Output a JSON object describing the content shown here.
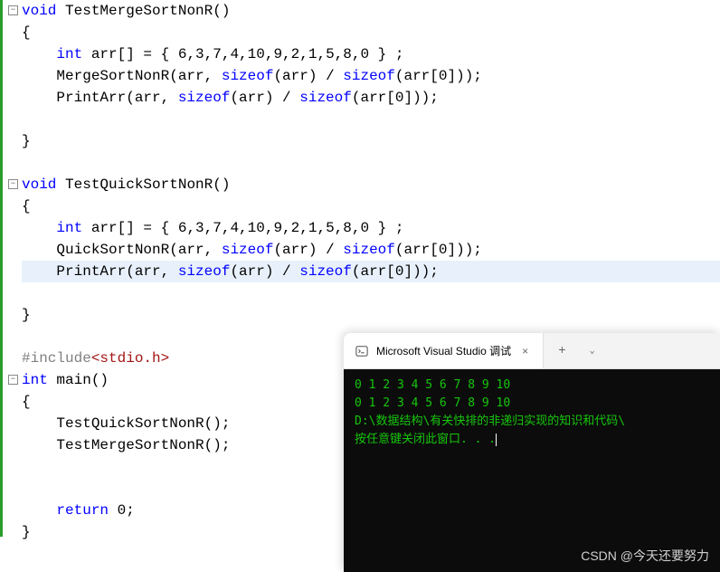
{
  "code": {
    "lines": [
      {
        "collapse": true,
        "segments": [
          {
            "cls": "kw",
            "t": "void"
          },
          {
            "cls": "",
            "t": " "
          },
          {
            "cls": "fn",
            "t": "TestMergeSortNonR"
          },
          {
            "cls": "",
            "t": "()"
          }
        ]
      },
      {
        "segments": [
          {
            "cls": "",
            "t": "{"
          }
        ]
      },
      {
        "segments": [
          {
            "cls": "",
            "t": "    "
          },
          {
            "cls": "kw",
            "t": "int"
          },
          {
            "cls": "",
            "t": " arr[] = { 6,3,7,4,10,9,2,1,5,8,0 } ;"
          }
        ]
      },
      {
        "segments": [
          {
            "cls": "",
            "t": "    MergeSortNonR(arr, "
          },
          {
            "cls": "kw",
            "t": "sizeof"
          },
          {
            "cls": "",
            "t": "(arr) / "
          },
          {
            "cls": "kw",
            "t": "sizeof"
          },
          {
            "cls": "",
            "t": "(arr[0]));"
          }
        ]
      },
      {
        "segments": [
          {
            "cls": "",
            "t": "    PrintArr(arr, "
          },
          {
            "cls": "kw",
            "t": "sizeof"
          },
          {
            "cls": "",
            "t": "(arr) / "
          },
          {
            "cls": "kw",
            "t": "sizeof"
          },
          {
            "cls": "",
            "t": "(arr[0]));"
          }
        ]
      },
      {
        "segments": [
          {
            "cls": "",
            "t": ""
          }
        ]
      },
      {
        "segments": [
          {
            "cls": "",
            "t": "}"
          }
        ]
      },
      {
        "segments": [
          {
            "cls": "",
            "t": ""
          }
        ]
      },
      {
        "collapse": true,
        "segments": [
          {
            "cls": "kw",
            "t": "void"
          },
          {
            "cls": "",
            "t": " "
          },
          {
            "cls": "fn",
            "t": "TestQuickSortNonR"
          },
          {
            "cls": "",
            "t": "()"
          }
        ]
      },
      {
        "segments": [
          {
            "cls": "",
            "t": "{"
          }
        ]
      },
      {
        "segments": [
          {
            "cls": "",
            "t": "    "
          },
          {
            "cls": "kw",
            "t": "int"
          },
          {
            "cls": "",
            "t": " arr[] = { 6,3,7,4,10,9,2,1,5,8,0 } ;"
          }
        ]
      },
      {
        "segments": [
          {
            "cls": "",
            "t": "    QuickSortNonR(arr, "
          },
          {
            "cls": "kw",
            "t": "sizeof"
          },
          {
            "cls": "",
            "t": "(arr) / "
          },
          {
            "cls": "kw",
            "t": "sizeof"
          },
          {
            "cls": "",
            "t": "(arr[0]));"
          }
        ]
      },
      {
        "highlight": true,
        "segments": [
          {
            "cls": "",
            "t": "    PrintArr(arr, "
          },
          {
            "cls": "kw",
            "t": "sizeof"
          },
          {
            "cls": "",
            "t": "(arr) / "
          },
          {
            "cls": "kw",
            "t": "sizeof"
          },
          {
            "cls": "",
            "t": "(arr[0]));"
          }
        ]
      },
      {
        "segments": [
          {
            "cls": "",
            "t": ""
          }
        ]
      },
      {
        "segments": [
          {
            "cls": "",
            "t": "}"
          }
        ]
      },
      {
        "segments": [
          {
            "cls": "",
            "t": ""
          }
        ]
      },
      {
        "segments": [
          {
            "cls": "include",
            "t": "#include"
          },
          {
            "cls": "header",
            "t": "<stdio.h>"
          }
        ]
      },
      {
        "collapse": true,
        "segments": [
          {
            "cls": "kw",
            "t": "int"
          },
          {
            "cls": "",
            "t": " "
          },
          {
            "cls": "fn",
            "t": "main"
          },
          {
            "cls": "",
            "t": "()"
          }
        ]
      },
      {
        "segments": [
          {
            "cls": "",
            "t": "{"
          }
        ]
      },
      {
        "segments": [
          {
            "cls": "",
            "t": "    TestQuickSortNonR();"
          }
        ]
      },
      {
        "segments": [
          {
            "cls": "",
            "t": "    TestMergeSortNonR();"
          }
        ]
      },
      {
        "segments": [
          {
            "cls": "",
            "t": ""
          }
        ]
      },
      {
        "segments": [
          {
            "cls": "",
            "t": ""
          }
        ]
      },
      {
        "segments": [
          {
            "cls": "",
            "t": "    "
          },
          {
            "cls": "kw",
            "t": "return"
          },
          {
            "cls": "",
            "t": " 0;"
          }
        ]
      },
      {
        "segments": [
          {
            "cls": "",
            "t": "}"
          }
        ]
      }
    ]
  },
  "terminal": {
    "tab_title": "Microsoft Visual Studio 调试",
    "tab_add": "+",
    "tab_dropdown": "⌄",
    "tab_close": "×",
    "output": [
      "0 1 2 3 4 5 6 7 8 9 10",
      "0 1 2 3 4 5 6 7 8 9 10",
      "",
      "D:\\数据结构\\有关快排的非递归实现的知识和代码\\",
      "",
      "按任意键关闭此窗口. . ."
    ]
  },
  "watermark": "CSDN @今天还要努力"
}
